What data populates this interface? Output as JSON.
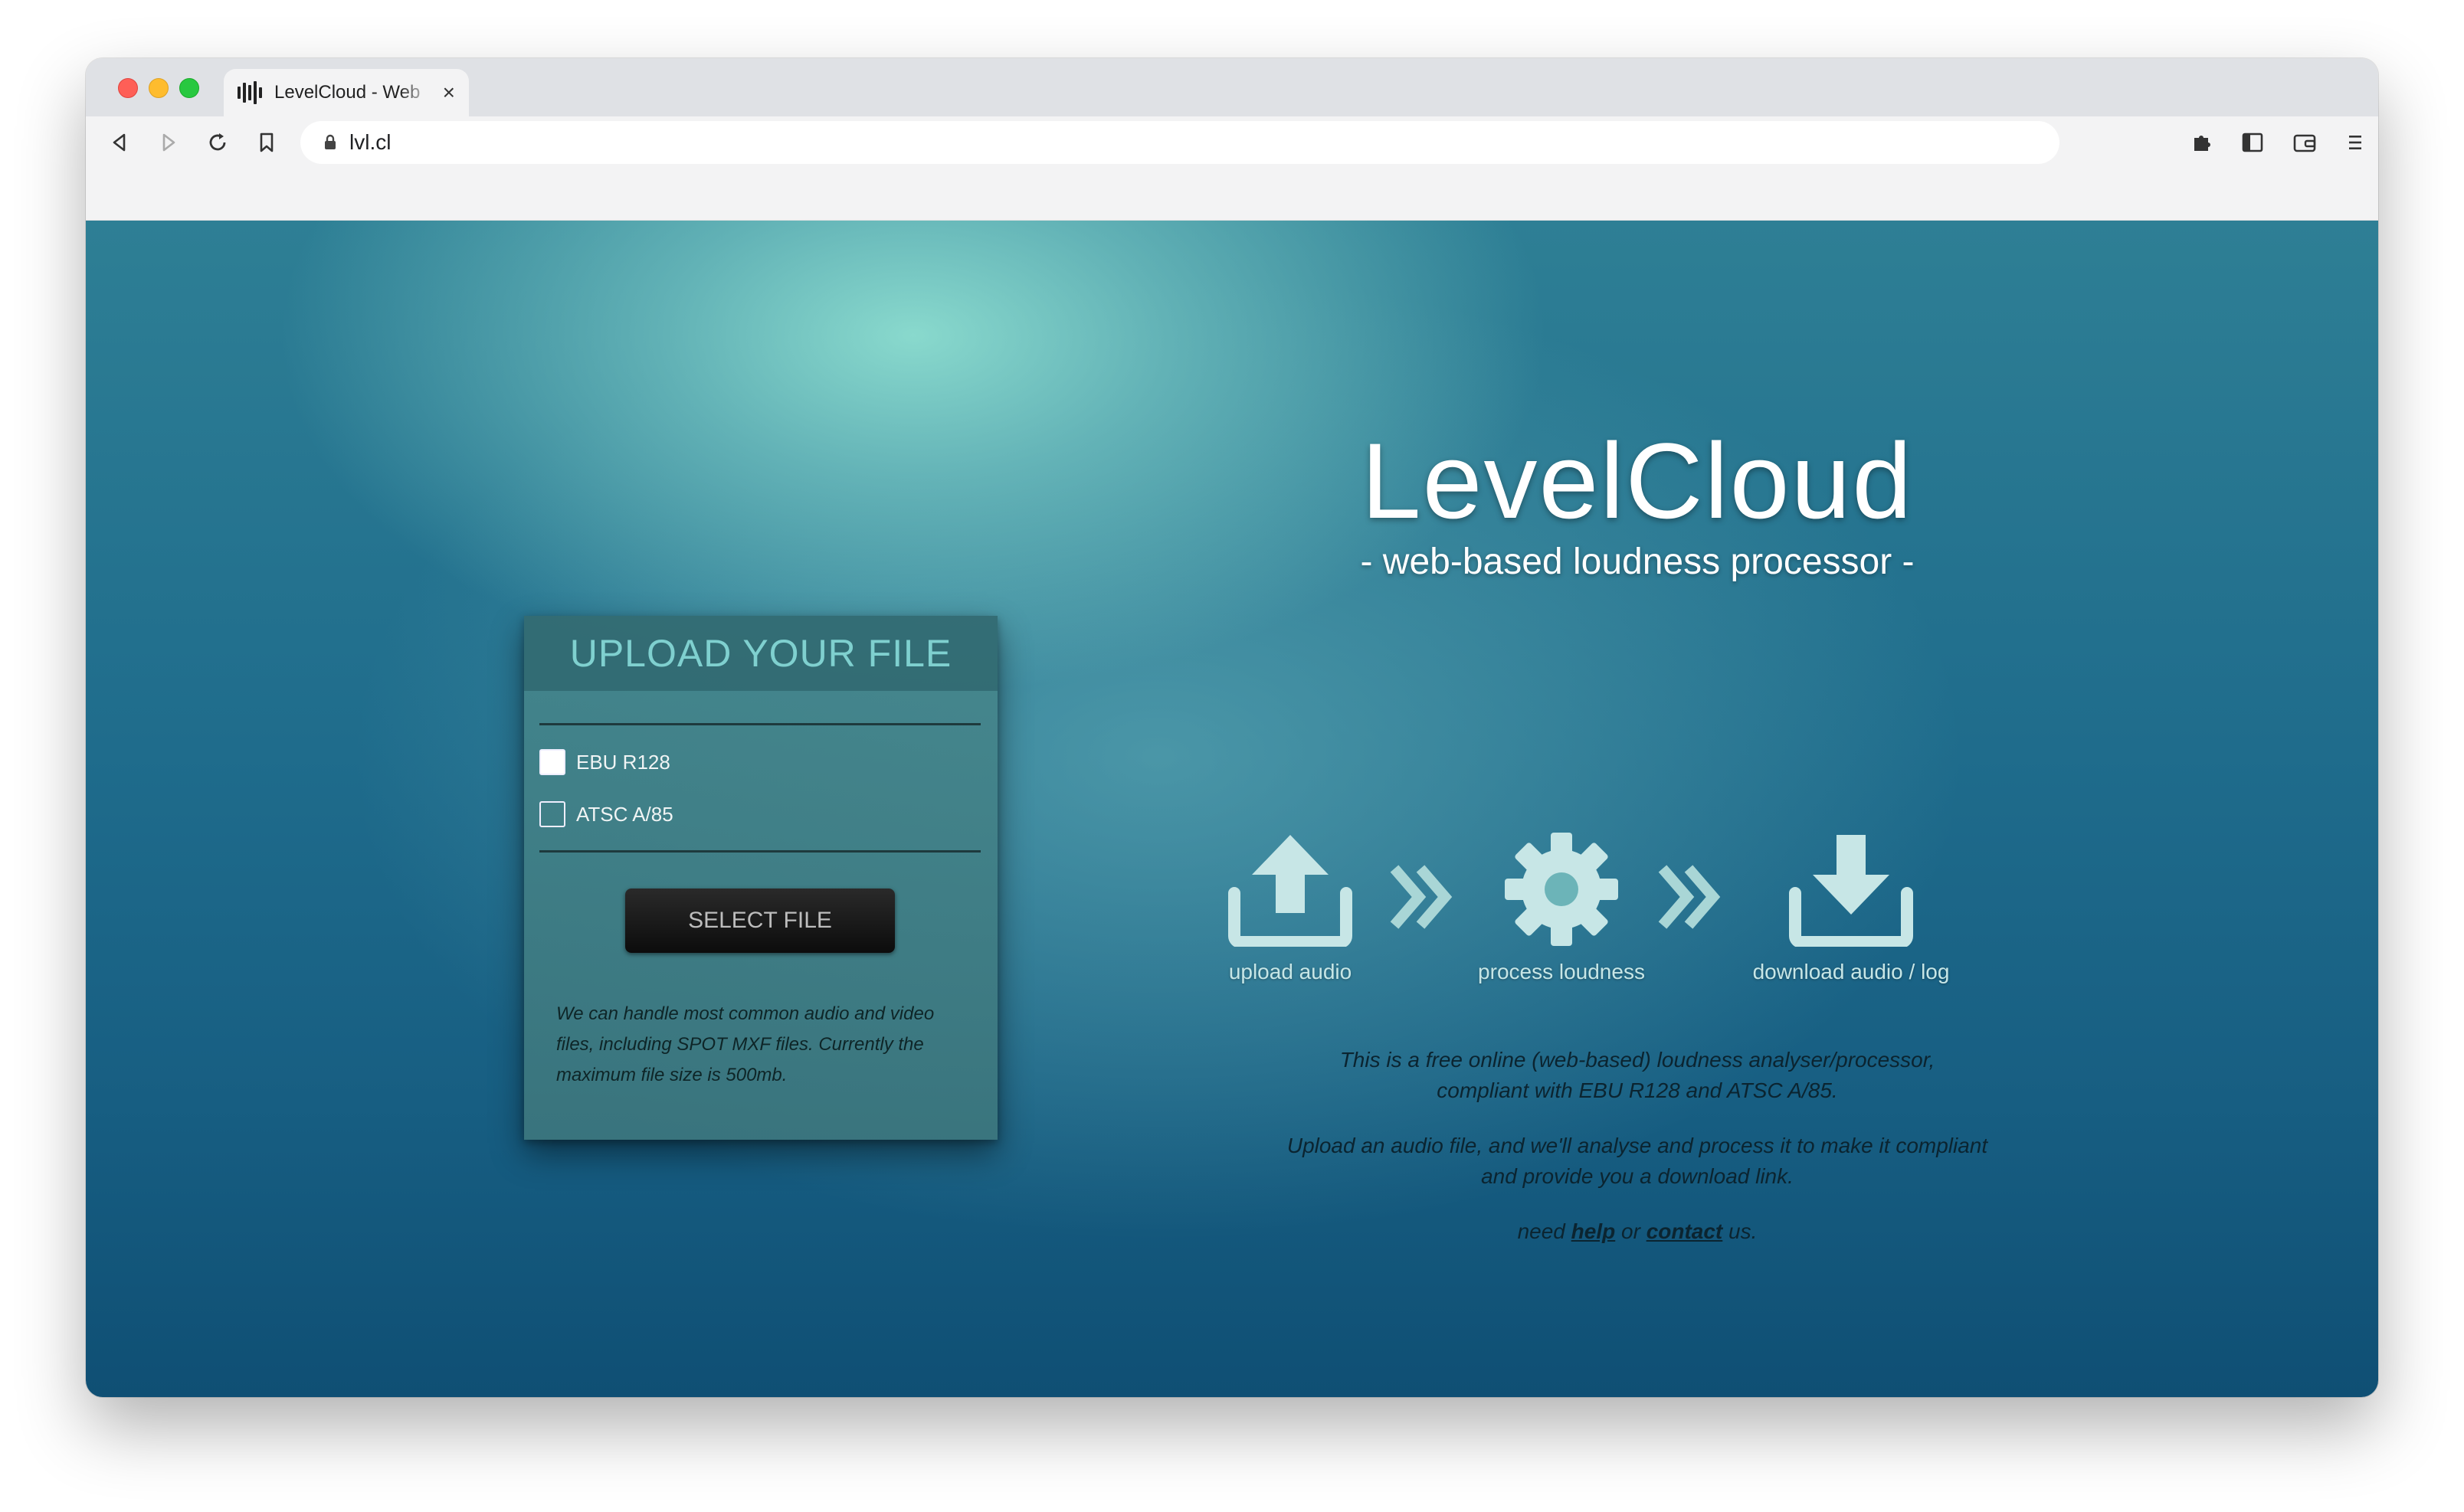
{
  "browser": {
    "tab_title": "LevelCloud - Web",
    "url": "lvl.cl"
  },
  "upload_panel": {
    "title": "UPLOAD YOUR FILE",
    "options": [
      {
        "label": "EBU R128",
        "checked": true
      },
      {
        "label": "ATSC A/85",
        "checked": false
      }
    ],
    "select_button": "SELECT FILE",
    "note": "We can handle most common audio and video files, including SPOT MXF files. Currently the maximum file size is 500mb."
  },
  "hero": {
    "title": "LevelCloud",
    "subtitle": "- web-based loudness processor -"
  },
  "steps": [
    {
      "label": "upload audio",
      "icon": "upload-icon"
    },
    {
      "label": "process loudness",
      "icon": "gear-icon"
    },
    {
      "label": "download audio / log",
      "icon": "download-icon"
    }
  ],
  "description": {
    "line1": "This is a free online (web-based) loudness analyser/processor,",
    "line2": "compliant with EBU R128 and ATSC A/85.",
    "line3": "Upload an audio file, and we'll analyse and process it to make it compliant",
    "line4": "and provide you a download link.",
    "help_prefix": "need",
    "help_link": "help",
    "help_middle": "or",
    "contact_link": "contact",
    "help_suffix": "us."
  },
  "colors": {
    "accent_title": "#7fd0cf",
    "button_bg": "#111111"
  }
}
